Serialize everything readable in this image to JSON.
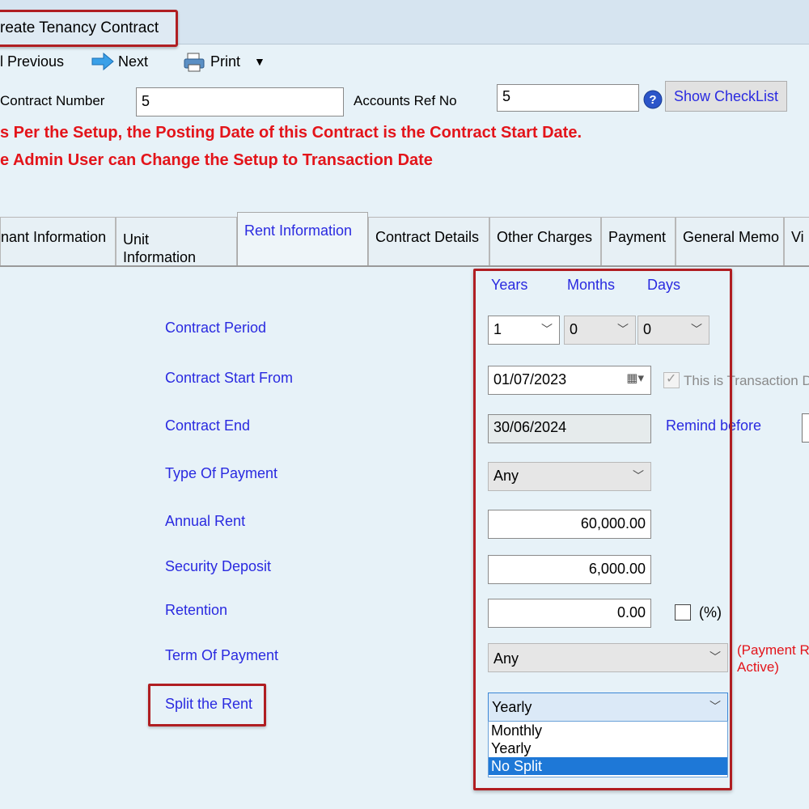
{
  "window": {
    "title": "reate Tenancy Contract"
  },
  "toolbar": {
    "previous": "l Previous",
    "next": "Next",
    "print": "Print"
  },
  "header": {
    "contract_number_label": "Contract Number",
    "contract_number_value": "5",
    "accounts_ref_label": "Accounts Ref No",
    "accounts_ref_value": "5",
    "show_checklist": "Show CheckList"
  },
  "warnings": [
    "s Per the Setup, the Posting Date of this Contract is the Contract Start Date.",
    "e Admin User can Change the Setup to Transaction Date"
  ],
  "tabs": [
    {
      "label": "nant Information"
    },
    {
      "label": "Unit",
      "label2": "Information"
    },
    {
      "label": "Rent Information"
    },
    {
      "label": "Contract Details"
    },
    {
      "label": "Other Charges"
    },
    {
      "label": "Payment"
    },
    {
      "label": "General Memo"
    },
    {
      "label": "Vi"
    }
  ],
  "period_headers": {
    "years": "Years",
    "months": "Months",
    "days": "Days"
  },
  "form": {
    "contract_period": {
      "label": "Contract Period",
      "years": "1",
      "months": "0",
      "days": "0"
    },
    "contract_start": {
      "label": "Contract Start From",
      "value": "01/07/2023",
      "transaction_label": "This is Transaction D"
    },
    "contract_end": {
      "label": "Contract End",
      "value": "30/06/2024",
      "remind_label": "Remind before"
    },
    "type_of_payment": {
      "label": "Type Of Payment",
      "value": "Any"
    },
    "annual_rent": {
      "label": "Annual Rent",
      "value": "60,000.00"
    },
    "security_deposit": {
      "label": "Security Deposit",
      "value": "6,000.00"
    },
    "retention": {
      "label": "Retention",
      "value": "0.00",
      "percent_label": "(%)"
    },
    "term_of_payment": {
      "label": "Term Of Payment",
      "value": "Any",
      "note1": "(Payment R",
      "note2": "Active)"
    },
    "split_rent": {
      "label": "Split the Rent",
      "value": "Yearly",
      "options": [
        "Monthly",
        "Yearly",
        "No Split"
      ],
      "highlighted": "No Split"
    }
  },
  "colors": {
    "accent_blue": "#2a2ae0",
    "warning_red": "#e3141a",
    "highlight_border": "#b01e22",
    "selection": "#1e78d7"
  }
}
